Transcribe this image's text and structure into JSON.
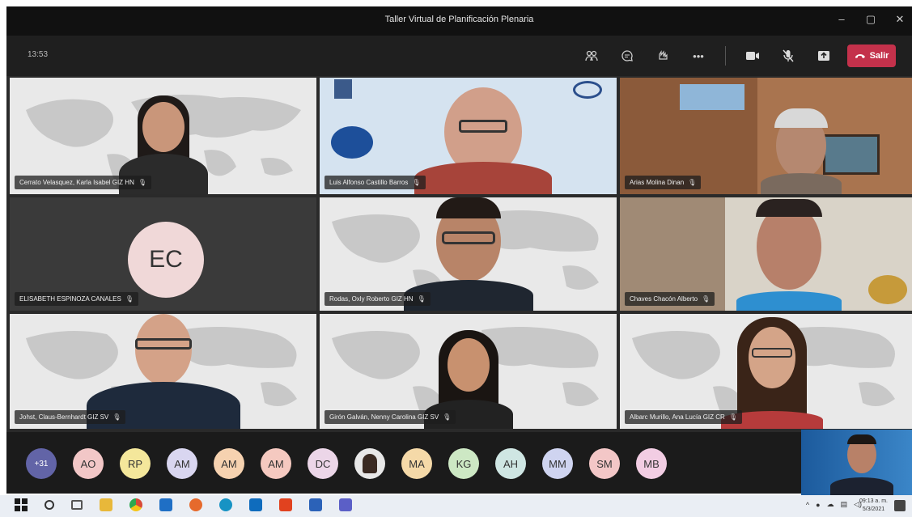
{
  "window": {
    "title": "Taller Virtual de Planificación Plenaria",
    "controls": [
      "minimize-icon",
      "maximize-icon",
      "close-icon"
    ]
  },
  "toolbar": {
    "timer": "13:53",
    "icons": [
      "people-icon",
      "chat-icon",
      "reactions-icon",
      "more-icon",
      "camera-icon",
      "mic-off-icon",
      "share-icon"
    ],
    "leave_label": "Salir",
    "leave_color": "#c4314b"
  },
  "tiles": [
    {
      "name": "Cerrato Velasquez, Karla Isabel GIZ HN",
      "type": "video"
    },
    {
      "name": "Luis Alfonso Castillo Barros",
      "type": "video"
    },
    {
      "name": "Arias Molina Dinan",
      "type": "video"
    },
    {
      "name": "ELISABETH ESPINOZA CANALES",
      "type": "avatar",
      "initials": "EC"
    },
    {
      "name": "Rodas, Oxly Roberto GIZ HN",
      "type": "video"
    },
    {
      "name": "Chaves Chacón Alberto",
      "type": "video"
    },
    {
      "name": "Johst, Claus-Bernhardt GIZ SV",
      "type": "video"
    },
    {
      "name": "Girón Galván, Nenny Carolina GIZ SV",
      "type": "video"
    },
    {
      "name": "Albarc Murillo, Ana Lucía GIZ CR",
      "type": "video"
    }
  ],
  "participants": [
    {
      "label": "+31",
      "color": "#6264a7"
    },
    {
      "label": "AO",
      "color": "#f2c7c7"
    },
    {
      "label": "RP",
      "color": "#f4e79b"
    },
    {
      "label": "AM",
      "color": "#d9d6f0"
    },
    {
      "label": "AM",
      "color": "#f6d2b0"
    },
    {
      "label": "AM",
      "color": "#f5c9c0"
    },
    {
      "label": "DC",
      "color": "#ecd6e8"
    },
    {
      "label": "",
      "color": "#e8e8e8",
      "photo": true
    },
    {
      "label": "MA",
      "color": "#f5d9a8"
    },
    {
      "label": "KG",
      "color": "#cde8c4"
    },
    {
      "label": "AH",
      "color": "#cfe6e3"
    },
    {
      "label": "MM",
      "color": "#cfd4f0"
    },
    {
      "label": "SM",
      "color": "#f3c7c7"
    },
    {
      "label": "MB",
      "color": "#f2cde3"
    }
  ],
  "taskbar": {
    "clock_time": "09:13 a. m.",
    "clock_date": "5/3/2021"
  }
}
